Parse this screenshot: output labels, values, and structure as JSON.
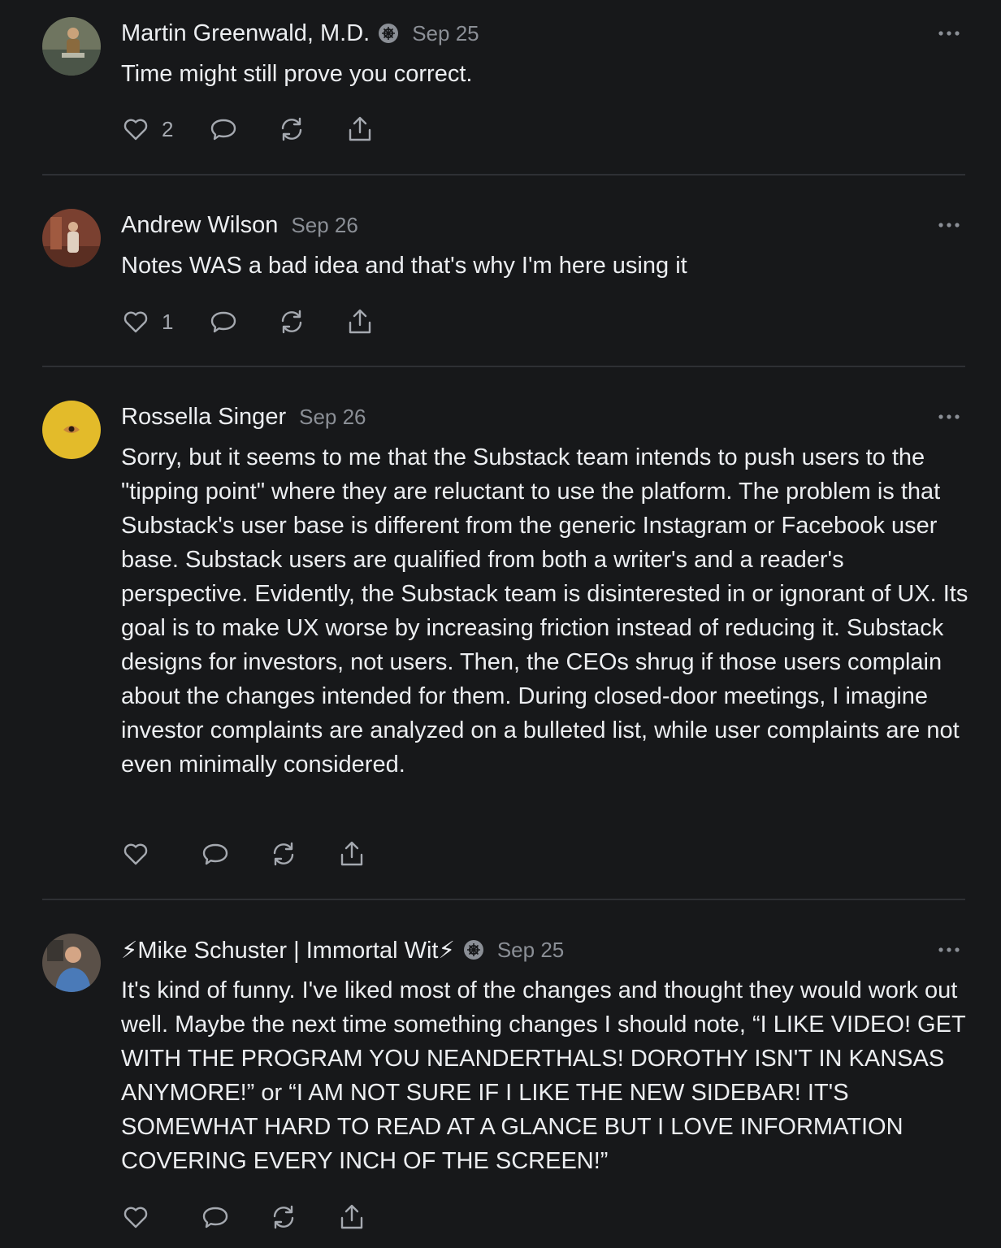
{
  "comments": [
    {
      "author": "Martin Greenwald, M.D.",
      "verified": true,
      "date": "Sep 25",
      "body": "Time might still prove you correct.",
      "likes": "2",
      "avatar_icon": "avatar-man-in-water"
    },
    {
      "author": "Andrew Wilson",
      "verified": false,
      "date": "Sep 26",
      "body": "Notes WAS a bad idea and that's why I'm here using it",
      "likes": "1",
      "avatar_icon": "avatar-figure-red-room"
    },
    {
      "author": "Rossella Singer",
      "verified": false,
      "date": "Sep 26",
      "body": "Sorry, but it seems to me that the Substack team intends to push users to the \"tipping point\" where they are reluctant to use the platform. The problem is that Substack's user base is different from the generic Instagram or Facebook user base. Substack users are qualified from both a writer's and a reader's perspective. Evidently, the Substack team is disinterested in or ignorant of UX. Its goal is to make UX worse by increasing friction instead of reducing it. Substack designs for investors, not users. Then, the CEOs shrug if those users complain about the changes intended for them. During closed-door meetings, I imagine investor complaints are analyzed on a bulleted list, while user complaints are not even minimally considered.",
      "likes": "",
      "avatar_icon": "avatar-eye-on-yellow"
    },
    {
      "author": "⚡Mike Schuster | Immortal Wit⚡",
      "verified": true,
      "date": "Sep 25",
      "body": "It's kind of funny. I've liked most of the changes and thought they would work out well. Maybe the next time something changes I should note, “I LIKE VIDEO! GET WITH THE PROGRAM YOU NEANDERTHALS! DOROTHY ISN'T IN KANSAS ANYMORE!” or “I AM NOT SURE IF I LIKE THE NEW SIDEBAR! IT'S SOMEWHAT HARD TO READ AT A GLANCE BUT I LOVE INFORMATION COVERING EVERY INCH OF THE SCREEN!”",
      "likes": "",
      "avatar_icon": "avatar-man-blue-shirt"
    }
  ],
  "colors": {
    "background": "#17181a",
    "text": "#eceef1",
    "muted": "#8b8f96",
    "icon": "#a5a9b0",
    "divider": "#2e3034"
  },
  "icons": {
    "like": "heart-icon",
    "reply": "comment-bubble-icon",
    "restack": "restack-icon",
    "share": "share-icon",
    "more": "more-dots-icon",
    "verified": "verified-badge-icon"
  }
}
